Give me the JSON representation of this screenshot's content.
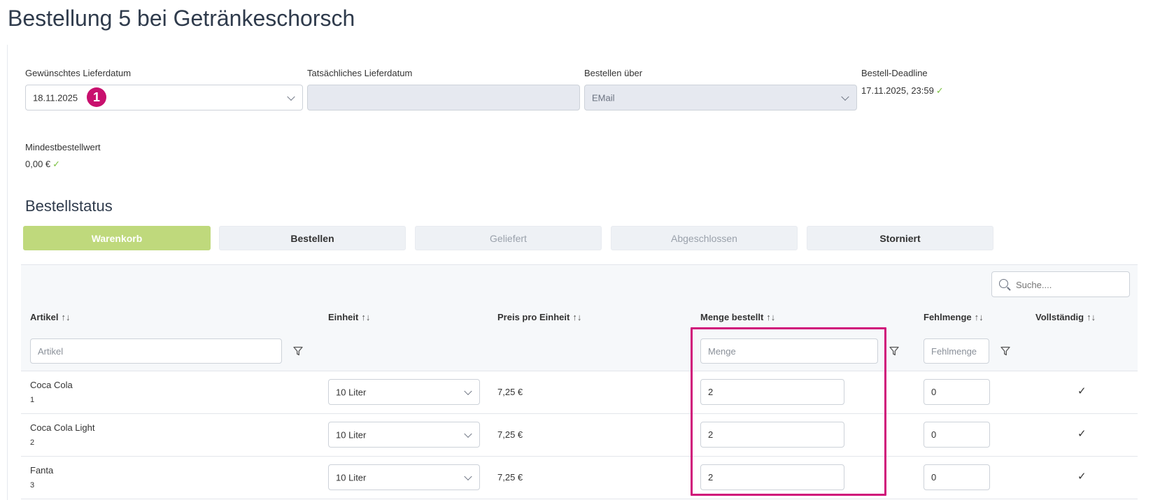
{
  "page": {
    "title": "Bestellung 5 bei Getränkeschorsch"
  },
  "fields": {
    "desired_date": {
      "label": "Gewünschtes Lieferdatum",
      "value": "18.11.2025",
      "badge": "1"
    },
    "actual_date": {
      "label": "Tatsächliches Lieferdatum",
      "value": ""
    },
    "order_via": {
      "label": "Bestellen über",
      "value": "EMail"
    },
    "deadline": {
      "label": "Bestell-Deadline",
      "value": "17.11.2025, 23:59"
    },
    "min_order": {
      "label": "Mindestbestellwert",
      "value": "0,00 €"
    },
    "check_glyph": "✓"
  },
  "status": {
    "title": "Bestellstatus",
    "buttons": [
      "Warenkorb",
      "Bestellen",
      "Geliefert",
      "Abgeschlossen",
      "Storniert"
    ]
  },
  "search": {
    "placeholder": "Suche...."
  },
  "table": {
    "sort_glyph": "↑↓",
    "columns": [
      "Artikel",
      "Einheit",
      "Preis pro Einheit",
      "Menge bestellt",
      "Fehlmenge",
      "Vollständig"
    ],
    "filters": {
      "artikel": "Artikel",
      "menge": "Menge",
      "fehlmenge": "Fehlmenge"
    },
    "rows": [
      {
        "name": "Coca Cola",
        "number": "1",
        "unit": "10 Liter",
        "price": "7,25 €",
        "qty": "2",
        "missing": "0",
        "complete": "✓"
      },
      {
        "name": "Coca Cola Light",
        "number": "2",
        "unit": "10 Liter",
        "price": "7,25 €",
        "qty": "2",
        "missing": "0",
        "complete": "✓"
      },
      {
        "name": "Fanta",
        "number": "3",
        "unit": "10 Liter",
        "price": "7,25 €",
        "qty": "2",
        "missing": "0",
        "complete": "✓"
      }
    ]
  },
  "colors": {
    "accent": "#bfd97c",
    "highlight": "#d0127a",
    "ok_green": "#7cc142"
  }
}
